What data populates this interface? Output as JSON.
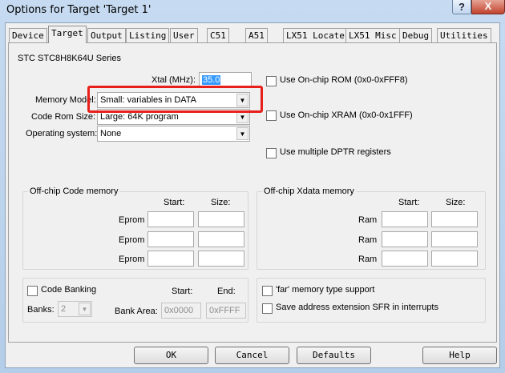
{
  "window": {
    "title": "Options for Target 'Target 1'",
    "help_glyph": "?",
    "close_glyph": "X"
  },
  "tabs": [
    "Device",
    "Target",
    "Output",
    "Listing",
    "User",
    "C51",
    "A51",
    "LX51 Locate",
    "LX51 Misc",
    "Debug",
    "Utilities"
  ],
  "target": {
    "device_name": "STC STC8H8K64U Series",
    "xtal_label": "Xtal (MHz):",
    "xtal_value": "35.0",
    "memory_model_label": "Memory Model:",
    "memory_model_value": "Small: variables in DATA",
    "code_rom_label": "Code Rom Size:",
    "code_rom_value": "Large: 64K program",
    "os_label": "Operating system:",
    "os_value": "None",
    "onchip_rom_label": "Use On-chip ROM (0x0-0xFFF8)",
    "onchip_xram_label": "Use On-chip XRAM (0x0-0x1FFF)",
    "multi_dptr_label": "Use multiple DPTR registers",
    "offchip_code": {
      "title": "Off-chip Code memory",
      "start_header": "Start:",
      "size_header": "Size:",
      "rows": [
        "Eprom",
        "Eprom",
        "Eprom"
      ]
    },
    "offchip_xdata": {
      "title": "Off-chip Xdata memory",
      "start_header": "Start:",
      "size_header": "Size:",
      "rows": [
        "Ram",
        "Ram",
        "Ram"
      ]
    },
    "code_banking": {
      "label": "Code Banking",
      "start_header": "Start:",
      "end_header": "End:",
      "banks_label": "Banks:",
      "banks_value": "2",
      "bank_area_label": "Bank Area:",
      "bank_start": "0x0000",
      "bank_end": "0xFFFF"
    },
    "far_memory_label": "'far' memory type support",
    "save_sfr_label": "Save address extension SFR in interrupts"
  },
  "buttons": {
    "ok": "OK",
    "cancel": "Cancel",
    "defaults": "Defaults",
    "help": "Help"
  },
  "colors": {
    "highlight": "#e8201b",
    "selection": "#3399ff"
  }
}
